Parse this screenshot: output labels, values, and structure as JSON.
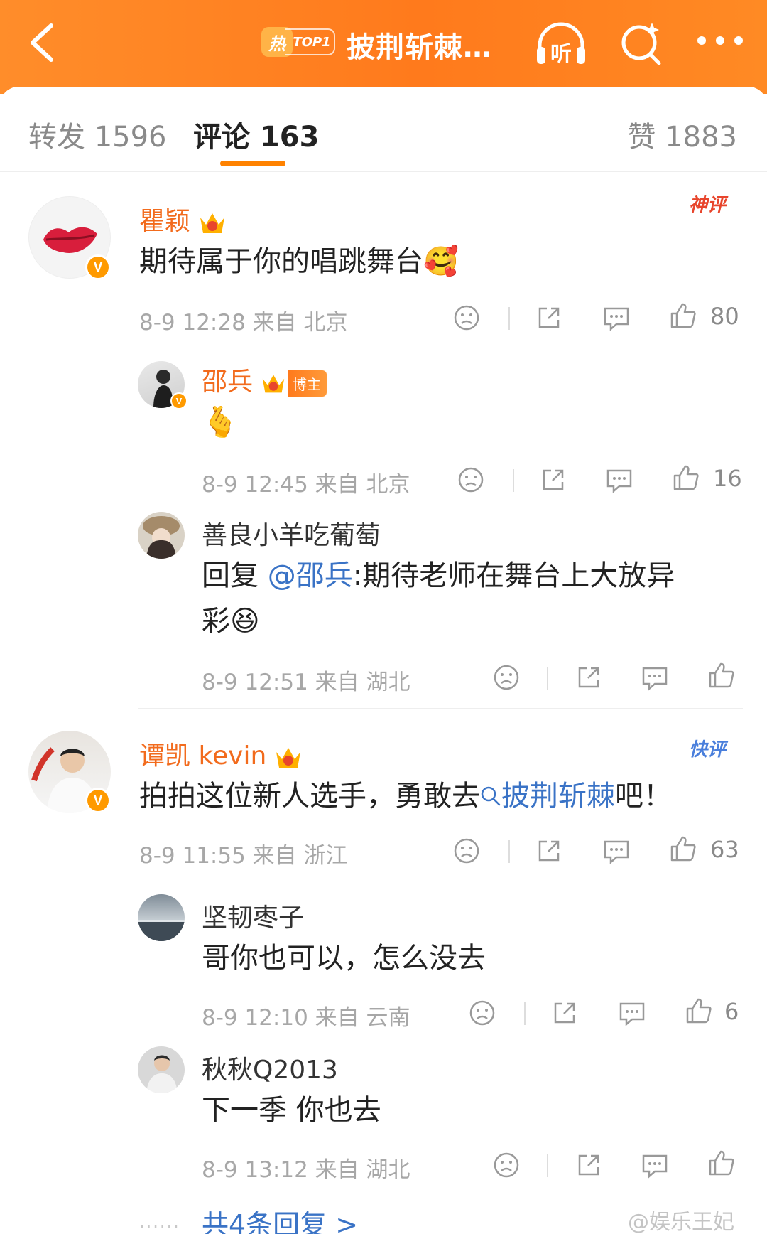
{
  "header": {
    "hot_char": "热",
    "hot_rank": "TOP1",
    "topic_title": "披荆斩棘…",
    "listen_icon": "headphones-listen-icon",
    "listen_char": "听",
    "search_icon": "search-sparkle-icon",
    "more_icon": "more-dots-icon"
  },
  "tabs": {
    "repost": "转发 1596",
    "comment": "评论 163",
    "like": "赞 1883"
  },
  "comments": [
    {
      "user": "瞿颖",
      "text": "期待属于你的唱跳舞台",
      "emoji": "🥰",
      "time": "8-9 12:28  来自 北京",
      "likes": "80",
      "badge": "神评",
      "replies": [
        {
          "user": "邵兵",
          "tag": "博主",
          "text": "🫰",
          "time": "8-9 12:45  来自 北京",
          "likes": "16"
        },
        {
          "user": "善良小羊吃葡萄",
          "reply_prefix": "回复 ",
          "mention": "@邵兵",
          "text_line1": ":期待老师在舞台上大放异",
          "text_line2": "彩",
          "emoji": "😆",
          "time": "8-9 12:51  来自 湖北",
          "likes": ""
        }
      ]
    },
    {
      "user": "谭凯 kevin",
      "text_before": "拍拍这位新人选手，勇敢去",
      "topic_link": "披荆斩棘",
      "text_after": "吧！",
      "time": "8-9 11:55  来自 浙江",
      "likes": "63",
      "badge": "快评",
      "replies": [
        {
          "user": "坚韧枣子",
          "text": "哥你也可以，怎么没去",
          "time": "8-9 12:10  来自 云南",
          "likes": "6"
        },
        {
          "user": "秋秋Q2013",
          "text": "下一季 你也去",
          "time": "8-9 13:12  来自 湖北",
          "likes": ""
        }
      ],
      "more_replies": "共4条回复 >"
    }
  ],
  "watermark": "@娱乐王妃",
  "colors": {
    "header_orange": "#ff7a1c",
    "vip_name": "#f26b1d",
    "link_blue": "#3a73c6",
    "tab_indicator": "#ff8200",
    "verified_badge": "#ff9a00"
  }
}
